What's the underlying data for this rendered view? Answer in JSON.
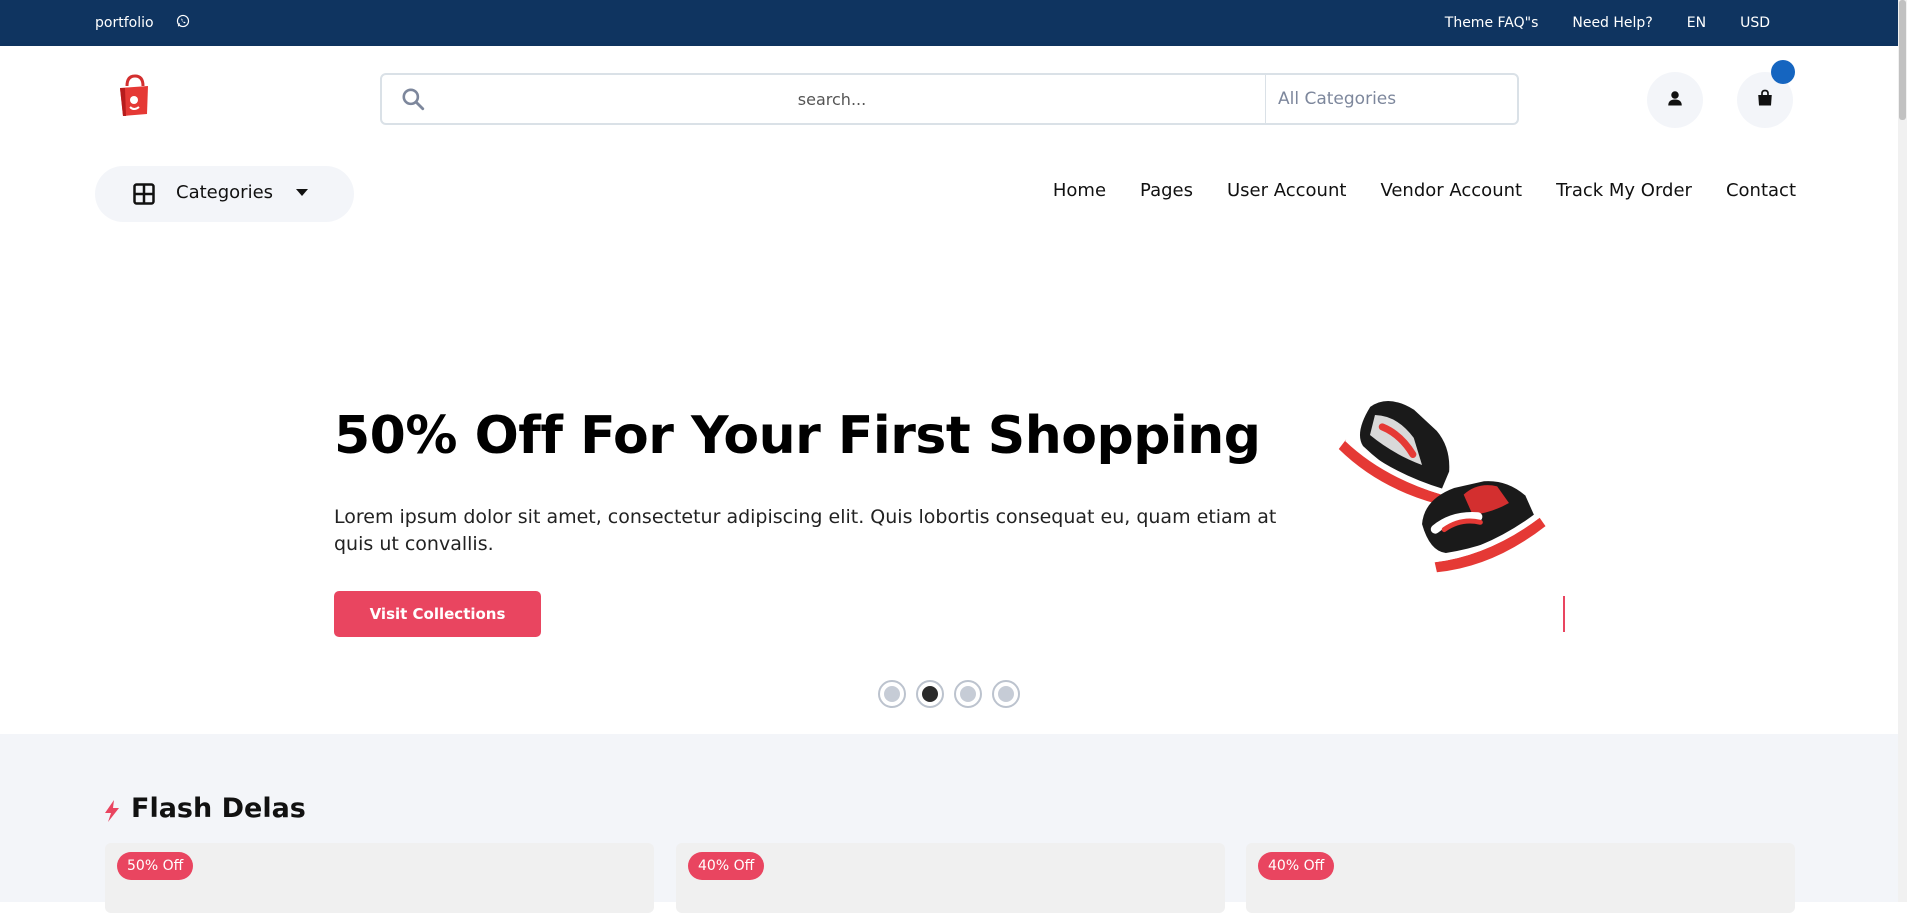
{
  "topbar": {
    "portfolio_label": "portfolio",
    "links": [
      "Theme FAQ\"s",
      "Need Help?",
      "EN",
      "USD"
    ]
  },
  "header": {
    "search_placeholder": "search...",
    "category_select": "All Categories",
    "categories_button": "Categories",
    "nav": [
      "Home",
      "Pages",
      "User Account",
      "Vendor Account",
      "Track My Order",
      "Contact"
    ]
  },
  "hero": {
    "title": "50% Off For Your First Shopping",
    "description": "Lorem ipsum dolor sit amet, consectetur adipiscing elit. Quis lobortis consequat eu, quam etiam at quis ut convallis.",
    "cta": "Visit Collections",
    "slides_total": 4,
    "active_slide": 2
  },
  "flash": {
    "title": "Flash Delas",
    "cards": [
      {
        "tag": "50% Off"
      },
      {
        "tag": "40% Off"
      },
      {
        "tag": "40% Off"
      }
    ]
  },
  "colors": {
    "topbar_bg": "#0f3460",
    "accent": "#e94560",
    "cart_badge": "#1565c0"
  }
}
